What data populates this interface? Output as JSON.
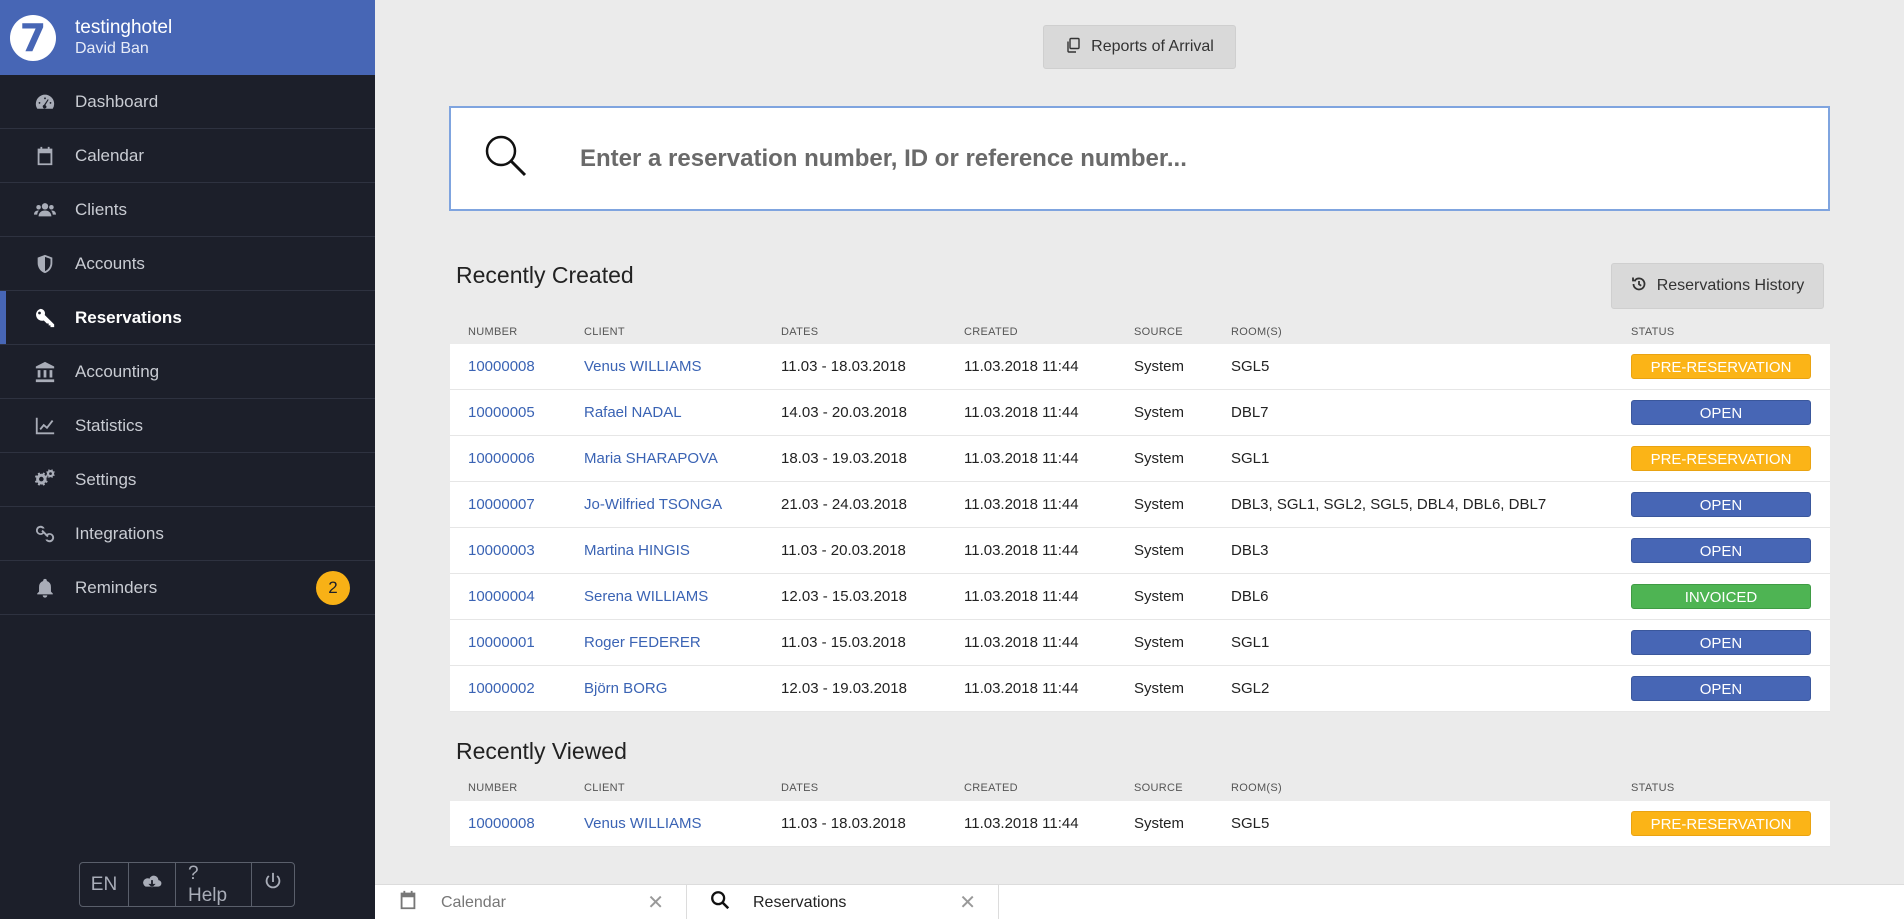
{
  "brand": {
    "logo_glyph": "7",
    "hotel": "testinghotel",
    "user": "David Ban"
  },
  "sidebar": {
    "items": [
      {
        "label": "Dashboard",
        "icon": "dashboard-icon"
      },
      {
        "label": "Calendar",
        "icon": "calendar-icon"
      },
      {
        "label": "Clients",
        "icon": "users-icon"
      },
      {
        "label": "Accounts",
        "icon": "shield-icon"
      },
      {
        "label": "Reservations",
        "icon": "key-icon",
        "active": true
      },
      {
        "label": "Accounting",
        "icon": "bank-icon"
      },
      {
        "label": "Statistics",
        "icon": "line-chart-icon"
      },
      {
        "label": "Settings",
        "icon": "gears-icon"
      },
      {
        "label": "Integrations",
        "icon": "link-icon"
      },
      {
        "label": "Reminders",
        "icon": "bell-icon",
        "badge": "2"
      }
    ],
    "footer": {
      "lang": "EN",
      "help": "? Help"
    }
  },
  "toolbar": {
    "arrival_label": "Reports of Arrival",
    "history_label": "Reservations History"
  },
  "search": {
    "placeholder": "Enter a reservation number, ID or reference number..."
  },
  "columns": {
    "number": "NUMBER",
    "client": "CLIENT",
    "dates": "DATES",
    "created": "CREATED",
    "source": "SOURCE",
    "rooms": "ROOM(S)",
    "status": "STATUS"
  },
  "recently_created": {
    "title": "Recently Created",
    "rows": [
      {
        "number": "10000008",
        "client": "Venus WILLIAMS",
        "dates": "11.03 - 18.03.2018",
        "created": "11.03.2018 11:44",
        "source": "System",
        "rooms": "SGL5",
        "status": "PRE-RESERVATION"
      },
      {
        "number": "10000005",
        "client": "Rafael NADAL",
        "dates": "14.03 - 20.03.2018",
        "created": "11.03.2018 11:44",
        "source": "System",
        "rooms": "DBL7",
        "status": "OPEN"
      },
      {
        "number": "10000006",
        "client": "Maria SHARAPOVA",
        "dates": "18.03 - 19.03.2018",
        "created": "11.03.2018 11:44",
        "source": "System",
        "rooms": "SGL1",
        "status": "PRE-RESERVATION"
      },
      {
        "number": "10000007",
        "client": "Jo-Wilfried TSONGA",
        "dates": "21.03 - 24.03.2018",
        "created": "11.03.2018 11:44",
        "source": "System",
        "rooms": "DBL3, SGL1, SGL2, SGL5, DBL4, DBL6, DBL7",
        "status": "OPEN"
      },
      {
        "number": "10000003",
        "client": "Martina HINGIS",
        "dates": "11.03 - 20.03.2018",
        "created": "11.03.2018 11:44",
        "source": "System",
        "rooms": "DBL3",
        "status": "OPEN"
      },
      {
        "number": "10000004",
        "client": "Serena WILLIAMS",
        "dates": "12.03 - 15.03.2018",
        "created": "11.03.2018 11:44",
        "source": "System",
        "rooms": "DBL6",
        "status": "INVOICED"
      },
      {
        "number": "10000001",
        "client": "Roger FEDERER",
        "dates": "11.03 - 15.03.2018",
        "created": "11.03.2018 11:44",
        "source": "System",
        "rooms": "SGL1",
        "status": "OPEN"
      },
      {
        "number": "10000002",
        "client": "Björn BORG",
        "dates": "12.03 - 19.03.2018",
        "created": "11.03.2018 11:44",
        "source": "System",
        "rooms": "SGL2",
        "status": "OPEN"
      }
    ]
  },
  "recently_viewed": {
    "title": "Recently Viewed",
    "rows": [
      {
        "number": "10000008",
        "client": "Venus WILLIAMS",
        "dates": "11.03 - 18.03.2018",
        "created": "11.03.2018 11:44",
        "source": "System",
        "rooms": "SGL5",
        "status": "PRE-RESERVATION"
      }
    ]
  },
  "tabs": [
    {
      "label": "Calendar",
      "icon": "calendar-icon"
    },
    {
      "label": "Reservations",
      "icon": "search-icon"
    }
  ],
  "colors": {
    "brand": "#4766b5",
    "sidebar": "#1c1f2a",
    "pre_reservation": "#fbb417",
    "open": "#4766b5",
    "invoiced": "#4eb453",
    "badge": "#f8b116"
  }
}
